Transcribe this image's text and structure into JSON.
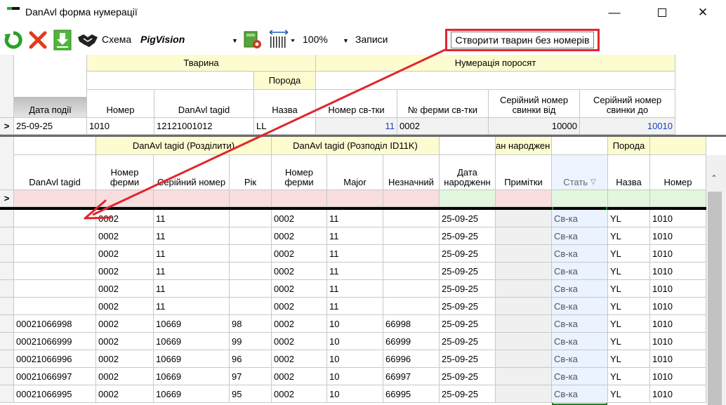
{
  "window": {
    "title": "DanAvl форма нумерації",
    "controls": [
      "minimize",
      "maximize",
      "close"
    ]
  },
  "toolbar": {
    "schema_label": "Схема",
    "schema_value": "PigVision",
    "zoom_value": "100%",
    "records_label": "Записи",
    "create_button": "Створити тварин без номерів",
    "icons": [
      "refresh-icon",
      "delete-icon",
      "download-icon",
      "handshake-icon",
      "settings-icon",
      "barcode-icon"
    ]
  },
  "top_grid": {
    "groups": {
      "animal": "Тварина",
      "breed": "Порода",
      "piglet_numbering": "Нумерація поросят"
    },
    "columns": [
      "Дата події",
      "Номер",
      "DanAvl tagid",
      "Назва",
      "Номер св-тки",
      "№ ферми св-тки",
      "Серійний номер свинки від",
      "Серійний номер свинки до"
    ],
    "row": {
      "indicator": ">",
      "event_date": "25-09-25",
      "number": "1010",
      "tagid": "12121001012",
      "breed": "LL",
      "sow_number": "11",
      "sow_farm": "0002",
      "serial_from": "10000",
      "serial_to": "10010"
    }
  },
  "bottom_grid": {
    "groups": {
      "split": "DanAvl tagid (Розділити)",
      "split_id11k": "DanAvl tagid (Розподіл ID11K)",
      "birth": "ан народжен",
      "breed": "Порода"
    },
    "columns": [
      "DanAvl tagid",
      "Номер ферми",
      "Серійний номер",
      "Рік",
      "Номер ферми",
      "Major",
      "Незначний",
      "Дата народженн",
      "Примітки",
      "Стать",
      "Назва",
      "Номер"
    ],
    "new_row_indicator": ">",
    "rows": [
      [
        "",
        "0002",
        "11",
        "",
        "0002",
        "11",
        "",
        "25-09-25",
        "",
        "Св-ка",
        "YL",
        "1010"
      ],
      [
        "",
        "0002",
        "11",
        "",
        "0002",
        "11",
        "",
        "25-09-25",
        "",
        "Св-ка",
        "YL",
        "1010"
      ],
      [
        "",
        "0002",
        "11",
        "",
        "0002",
        "11",
        "",
        "25-09-25",
        "",
        "Св-ка",
        "YL",
        "1010"
      ],
      [
        "",
        "0002",
        "11",
        "",
        "0002",
        "11",
        "",
        "25-09-25",
        "",
        "Св-ка",
        "YL",
        "1010"
      ],
      [
        "",
        "0002",
        "11",
        "",
        "0002",
        "11",
        "",
        "25-09-25",
        "",
        "Св-ка",
        "YL",
        "1010"
      ],
      [
        "",
        "0002",
        "11",
        "",
        "0002",
        "11",
        "",
        "25-09-25",
        "",
        "Св-ка",
        "YL",
        "1010"
      ],
      [
        "00021066998",
        "0002",
        "10669",
        "98",
        "0002",
        "10",
        "66998",
        "25-09-25",
        "",
        "Св-ка",
        "YL",
        "1010"
      ],
      [
        "00021066999",
        "0002",
        "10669",
        "99",
        "0002",
        "10",
        "66999",
        "25-09-25",
        "",
        "Св-ка",
        "YL",
        "1010"
      ],
      [
        "00021066996",
        "0002",
        "10669",
        "96",
        "0002",
        "10",
        "66996",
        "25-09-25",
        "",
        "Св-ка",
        "YL",
        "1010"
      ],
      [
        "00021066997",
        "0002",
        "10669",
        "97",
        "0002",
        "10",
        "66997",
        "25-09-25",
        "",
        "Св-ка",
        "YL",
        "1010"
      ],
      [
        "00021066995",
        "0002",
        "10669",
        "95",
        "0002",
        "10",
        "66995",
        "25-09-25",
        "",
        "Св-ка",
        "YL",
        "1010"
      ]
    ]
  },
  "colors": {
    "annotation_red": "#e0262c",
    "group_header_bg": "#fdfbd0",
    "new_row_pink": "#f8dede",
    "new_row_green": "#e3f6de",
    "selected_column_bg": "#eaf3ff",
    "selected_column_border": "#1e7d1e",
    "blue_value": "#1a3fc4"
  }
}
